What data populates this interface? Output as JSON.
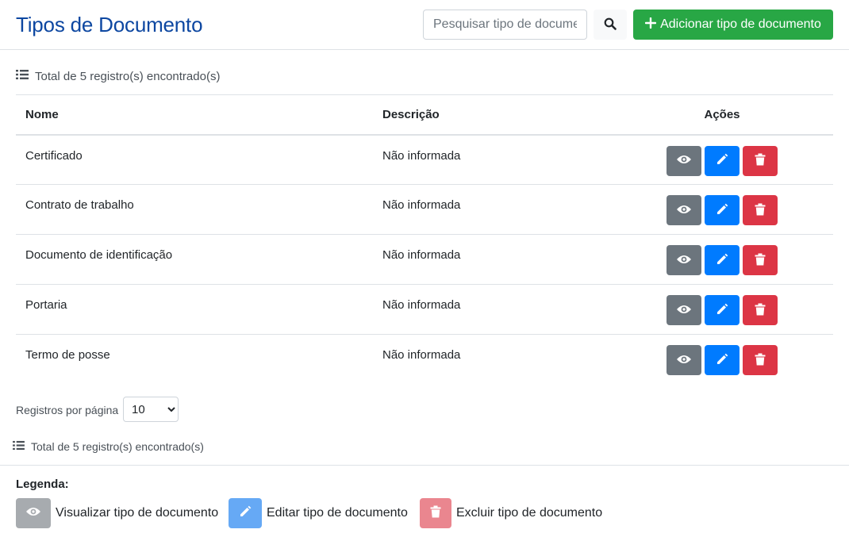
{
  "header": {
    "title": "Tipos de Documento",
    "search_placeholder": "Pesquisar tipo de documento",
    "add_label": "Adicionar tipo de documento"
  },
  "summary": {
    "total_text": "Total de 5 registro(s) encontrado(s)"
  },
  "table": {
    "columns": [
      "Nome",
      "Descrição",
      "Ações"
    ],
    "rows": [
      {
        "nome": "Certificado",
        "descricao": "Não informada"
      },
      {
        "nome": "Contrato de trabalho",
        "descricao": "Não informada"
      },
      {
        "nome": "Documento de identificação",
        "descricao": "Não informada"
      },
      {
        "nome": "Portaria",
        "descricao": "Não informada"
      },
      {
        "nome": "Termo de posse",
        "descricao": "Não informada"
      }
    ]
  },
  "pagination": {
    "per_page_label": "Registros por página",
    "per_page_value": "10"
  },
  "legend": {
    "title": "Legenda:",
    "view_label": "Visualizar tipo de documento",
    "edit_label": "Editar tipo de documento",
    "delete_label": "Excluir tipo de documento"
  },
  "icons": {
    "view": "eye-icon",
    "edit": "pencil-icon",
    "delete": "trash-icon",
    "search": "search-icon",
    "add": "plus-icon",
    "list": "list-icon"
  },
  "colors": {
    "title": "#0d47a1",
    "add_button": "#28a745",
    "view_button": "#6c757d",
    "edit_button": "#007bff",
    "delete_button": "#dc3545"
  }
}
